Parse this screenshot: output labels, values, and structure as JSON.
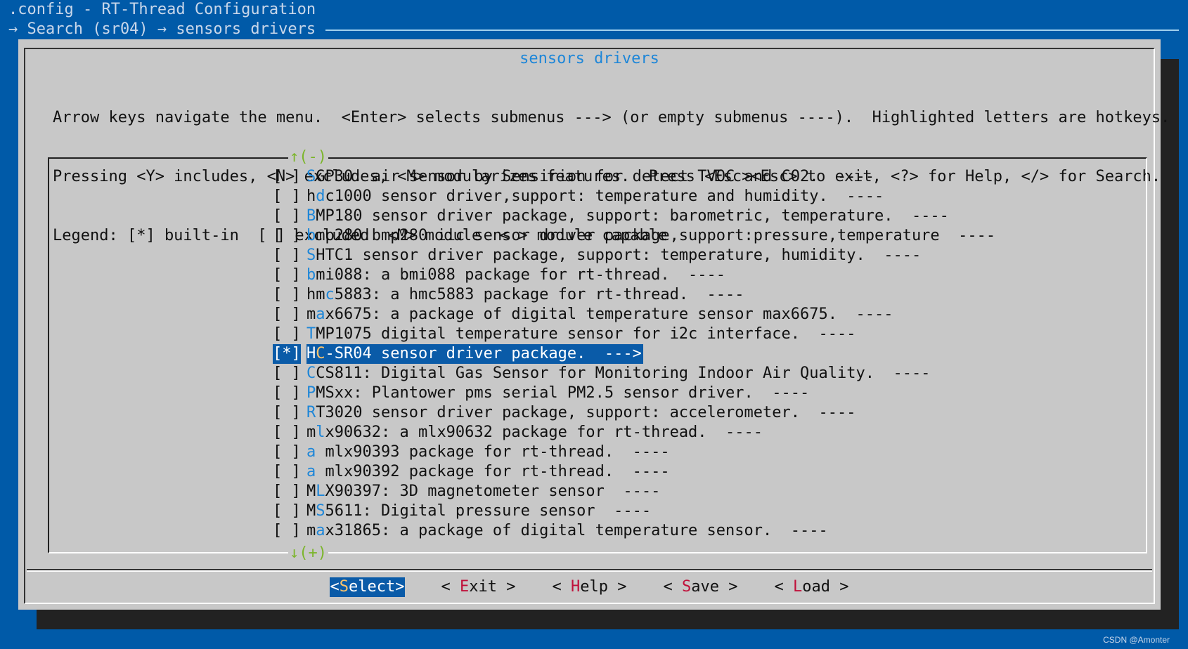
{
  "window_title": ".config - RT-Thread Configuration",
  "breadcrumb": "→ Search (sr04) → sensors drivers",
  "dialog": {
    "title": "sensors drivers",
    "help_lines": [
      "Arrow keys navigate the menu.  <Enter> selects submenus ---> (or empty submenus ----).  Highlighted letters are hotkeys.",
      "Pressing <Y> includes, <N> excludes, <M> modularizes features.  Press <Esc><Esc> to exit, <?> for Help, </> for Search.",
      "Legend: [*] built-in  [ ] excluded  <M> module  < > module capable"
    ],
    "scroll_up": "↑(-)",
    "scroll_down": "↓(+)"
  },
  "items": [
    {
      "mark": "[ ]",
      "pre": "",
      "hk": "S",
      "post": "GP30: air sensor by Sensirion for detect TVOC and CO2.  ----"
    },
    {
      "mark": "[ ]",
      "pre": "h",
      "hk": "d",
      "post": "c1000 sensor driver,support: temperature and humidity.  ----"
    },
    {
      "mark": "[ ]",
      "pre": "",
      "hk": "B",
      "post": "MP180 sensor driver package, support: barometric, temperature.  ----"
    },
    {
      "mark": "[ ]",
      "pre": "",
      "hk": "b",
      "post": "mp280:bmp280 iic sensor driver package,support:pressure,temperature  ----"
    },
    {
      "mark": "[ ]",
      "pre": "",
      "hk": "S",
      "post": "HTC1 sensor driver package, support: temperature, humidity.  ----"
    },
    {
      "mark": "[ ]",
      "pre": "",
      "hk": "b",
      "post": "mi088: a bmi088 package for rt-thread.  ----"
    },
    {
      "mark": "[ ]",
      "pre": "hm",
      "hk": "c",
      "post": "5883: a hmc5883 package for rt-thread.  ----"
    },
    {
      "mark": "[ ]",
      "pre": "m",
      "hk": "a",
      "post": "x6675: a package of digital temperature sensor max6675.  ----"
    },
    {
      "mark": "[ ]",
      "pre": "",
      "hk": "T",
      "post": "MP1075 digital temperature sensor for i2c interface.  ----"
    },
    {
      "mark": "[*]",
      "pre": "H",
      "hk": "C",
      "post": "-SR04 sensor driver package.  --->",
      "selected": true
    },
    {
      "mark": "[ ]",
      "pre": "",
      "hk": "C",
      "post": "CS811: Digital Gas Sensor for Monitoring Indoor Air Quality.  ----"
    },
    {
      "mark": "[ ]",
      "pre": "",
      "hk": "P",
      "post": "MSxx: Plantower pms serial PM2.5 sensor driver.  ----"
    },
    {
      "mark": "[ ]",
      "pre": "",
      "hk": "R",
      "post": "T3020 sensor driver package, support: accelerometer.  ----"
    },
    {
      "mark": "[ ]",
      "pre": "m",
      "hk": "l",
      "post": "x90632: a mlx90632 package for rt-thread.  ----"
    },
    {
      "mark": "[ ]",
      "pre": "",
      "hk": "a",
      "post": " mlx90393 package for rt-thread.  ----"
    },
    {
      "mark": "[ ]",
      "pre": "",
      "hk": "a",
      "post": " mlx90392 package for rt-thread.  ----"
    },
    {
      "mark": "[ ]",
      "pre": "M",
      "hk": "L",
      "post": "X90397: 3D magnetometer sensor  ----"
    },
    {
      "mark": "[ ]",
      "pre": "M",
      "hk": "S",
      "post": "5611: Digital pressure sensor  ----"
    },
    {
      "mark": "[ ]",
      "pre": "m",
      "hk": "a",
      "post": "x31865: a package of digital temperature sensor.  ----"
    }
  ],
  "buttons": [
    {
      "open": "<",
      "hk": "S",
      "rest": "elect",
      "close": ">",
      "active": true
    },
    {
      "open": "< ",
      "hk": "E",
      "rest": "xit",
      "close": " >"
    },
    {
      "open": "< ",
      "hk": "H",
      "rest": "elp",
      "close": " >"
    },
    {
      "open": "< ",
      "hk": "S",
      "rest": "ave",
      "close": " >"
    },
    {
      "open": "< ",
      "hk": "L",
      "rest": "oad",
      "close": " >"
    }
  ],
  "watermark": "CSDN @Amonter",
  "colors": {
    "desktop_bg": "#005aa8",
    "dialog_bg": "#c8c8c8",
    "highlight_bg": "#0a5ba8",
    "hotkey_blue": "#1d86d8",
    "hotkey_red": "#c0103a",
    "selected_hotkey": "#ffc46a",
    "scroll_indicator": "#7bb52a"
  }
}
